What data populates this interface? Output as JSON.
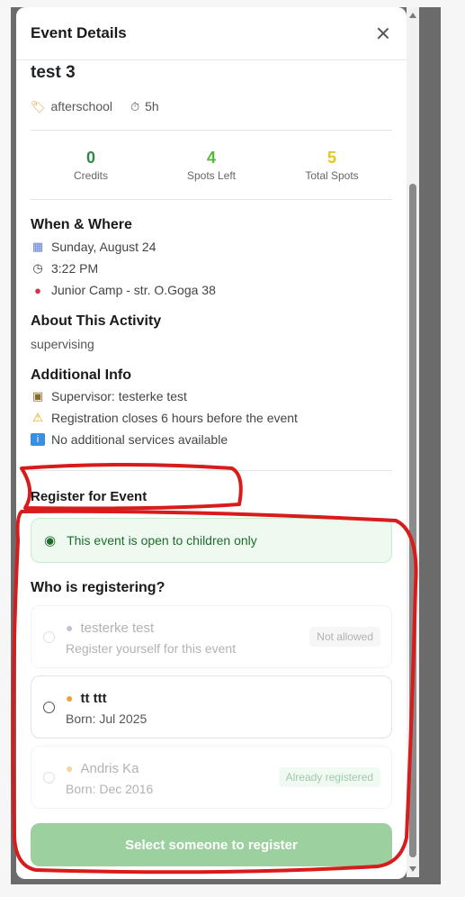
{
  "header": {
    "title": "Event Details"
  },
  "event": {
    "title": "test 3",
    "tag": "afterschool",
    "duration": "5h",
    "tag_icon": "tag-icon",
    "duration_icon": "stopwatch-icon"
  },
  "stats": [
    {
      "value": "0",
      "label": "Credits",
      "color": "#2e8a44"
    },
    {
      "value": "4",
      "label": "Spots Left",
      "color": "#55b93b"
    },
    {
      "value": "5",
      "label": "Total Spots",
      "color": "#e8c713"
    }
  ],
  "when_where": {
    "title": "When & Where",
    "date": "Sunday, August 24",
    "time": "3:22 PM",
    "location": "Junior Camp - str. O.Goga 38"
  },
  "about": {
    "title": "About This Activity",
    "text": "supervising"
  },
  "additional": {
    "title": "Additional Info",
    "supervisor": "Supervisor: testerke test",
    "registration": "Registration closes 6 hours before the event",
    "services": "No additional services available"
  },
  "register": {
    "title": "Register for Event",
    "notice": "This event is open to children only",
    "who_title": "Who is registering?",
    "options": [
      {
        "name": "testerke test",
        "sub": "Register yourself for this event",
        "badge": "Not allowed",
        "icon": "person-icon"
      },
      {
        "name": "tt ttt",
        "sub": "Born: Jul 2025",
        "badge": "",
        "icon": "child-icon"
      },
      {
        "name": "Andris Ka",
        "sub": "Born: Dec 2016",
        "badge": "Already registered",
        "icon": "child-icon"
      }
    ],
    "button": "Select someone to register"
  },
  "colors": {
    "accent_green": "#9cd09f",
    "annotation_red": "#d81b1b"
  }
}
